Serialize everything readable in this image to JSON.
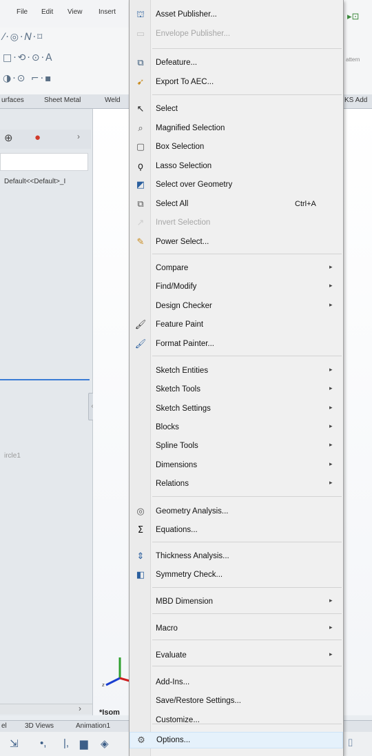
{
  "menubar": {
    "items": [
      "File",
      "Edit",
      "View",
      "Insert"
    ]
  },
  "command_tabs": [
    "urfaces",
    "Sheet Metal",
    "Weld",
    "KS Add"
  ],
  "left_panel": {
    "config_text": "Default<<Default>_I",
    "sketch_text": "ircle1"
  },
  "viewport": {
    "view_label": "*Isom"
  },
  "bottom_tabs": [
    "el",
    "3D Views",
    "Animation1"
  ],
  "toolbar_right_label": "attern",
  "menu": {
    "items": [
      {
        "label": "Asset Publisher...",
        "icon": "asset-publisher-icon",
        "glyph": "⛫",
        "color": "#2a5f9e",
        "disabled": false
      },
      {
        "label": "Envelope Publisher...",
        "icon": "envelope-publisher-icon",
        "glyph": "▭",
        "color": "#777",
        "disabled": true
      },
      {
        "label": "Defeature...",
        "icon": "defeature-icon",
        "glyph": "⧉",
        "color": "#3a5a7a",
        "disabled": false
      },
      {
        "label": "Export To AEC...",
        "icon": "export-aec-icon",
        "glyph": "➹",
        "color": "#c98a1b",
        "disabled": false
      },
      {
        "label": "Select",
        "icon": "select-arrow-icon",
        "glyph": "↖",
        "color": "#222",
        "disabled": false
      },
      {
        "label": "Magnified Selection",
        "icon": "magnifier-icon",
        "glyph": "⌕",
        "color": "#555",
        "disabled": false
      },
      {
        "label": "Box Selection",
        "icon": "box-selection-icon",
        "glyph": "▢",
        "color": "#555",
        "disabled": false
      },
      {
        "label": "Lasso Selection",
        "icon": "lasso-icon",
        "glyph": "ϙ",
        "color": "#222",
        "disabled": false
      },
      {
        "label": "Select over Geometry",
        "icon": "select-geometry-icon",
        "glyph": "◩",
        "color": "#2a5f9e",
        "disabled": false
      },
      {
        "label": "Select All",
        "shortcut": "Ctrl+A",
        "icon": "select-all-icon",
        "glyph": "⧉",
        "color": "#555",
        "disabled": false
      },
      {
        "label": "Invert Selection",
        "icon": "invert-selection-icon",
        "glyph": "↗",
        "color": "#999",
        "disabled": true
      },
      {
        "label": "Power Select...",
        "icon": "power-select-icon",
        "glyph": "✎",
        "color": "#c98a1b",
        "disabled": false
      },
      {
        "label": "Compare",
        "submenu": true,
        "disabled": false
      },
      {
        "label": "Find/Modify",
        "submenu": true,
        "disabled": false
      },
      {
        "label": "Design Checker",
        "submenu": true,
        "disabled": false
      },
      {
        "label": "Feature Paint",
        "icon": "feature-paint-icon",
        "glyph": "🖌",
        "color": "#333",
        "disabled": false
      },
      {
        "label": "Format Painter...",
        "icon": "format-painter-icon",
        "glyph": "🖌",
        "color": "#2a5f9e",
        "disabled": false
      },
      {
        "label": "Sketch Entities",
        "submenu": true,
        "disabled": false
      },
      {
        "label": "Sketch Tools",
        "submenu": true,
        "disabled": false
      },
      {
        "label": "Sketch Settings",
        "submenu": true,
        "disabled": false
      },
      {
        "label": "Blocks",
        "submenu": true,
        "disabled": false
      },
      {
        "label": "Spline Tools",
        "submenu": true,
        "disabled": false
      },
      {
        "label": "Dimensions",
        "submenu": true,
        "disabled": false
      },
      {
        "label": "Relations",
        "submenu": true,
        "disabled": false
      },
      {
        "label": "Geometry Analysis...",
        "icon": "geometry-analysis-icon",
        "glyph": "◎",
        "color": "#555",
        "disabled": false
      },
      {
        "label": "Equations...",
        "icon": "sigma-icon",
        "glyph": "Σ",
        "color": "#111",
        "disabled": false
      },
      {
        "label": "Thickness Analysis...",
        "icon": "thickness-analysis-icon",
        "glyph": "⇕",
        "color": "#2a5f9e",
        "disabled": false
      },
      {
        "label": "Symmetry Check...",
        "icon": "symmetry-check-icon",
        "glyph": "◧",
        "color": "#2a5f9e",
        "disabled": false
      },
      {
        "label": "MBD Dimension",
        "submenu": true,
        "disabled": false
      },
      {
        "label": "Macro",
        "submenu": true,
        "disabled": false
      },
      {
        "label": "Evaluate",
        "submenu": true,
        "disabled": false
      },
      {
        "label": "Add-Ins...",
        "disabled": false
      },
      {
        "label": "Save/Restore Settings...",
        "disabled": false
      },
      {
        "label": "Customize...",
        "disabled": false
      },
      {
        "label": "Options...",
        "icon": "gear-icon",
        "glyph": "⚙",
        "color": "#555",
        "disabled": false,
        "highlighted": true
      }
    ]
  }
}
